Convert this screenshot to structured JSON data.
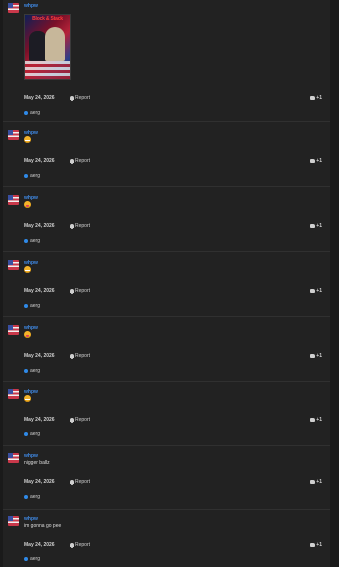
{
  "attachment": {
    "title_text": "Block & Stack"
  },
  "posts": [
    {
      "username": "whpw",
      "date": "May 24, 2026",
      "report_label": "Report",
      "like_label": "+1",
      "reactor": "aerg"
    },
    {
      "username": "whpw",
      "emoji": "grinning-emoji",
      "date": "May 24, 2026",
      "report_label": "Report",
      "like_label": "+1",
      "reactor": "aerg"
    },
    {
      "username": "whpw",
      "emoji": "tongue-emoji",
      "date": "May 24, 2026",
      "report_label": "Report",
      "like_label": "+1",
      "reactor": "aerg"
    },
    {
      "username": "whpw",
      "emoji": "grinning-emoji",
      "date": "May 24, 2026",
      "report_label": "Report",
      "like_label": "+1",
      "reactor": "aerg"
    },
    {
      "username": "whpw",
      "emoji": "tongue-emoji",
      "date": "May 24, 2026",
      "report_label": "Report",
      "like_label": "+1",
      "reactor": "aerg"
    },
    {
      "username": "whpw",
      "emoji": "grinning-emoji",
      "date": "May 24, 2026",
      "report_label": "Report",
      "like_label": "+1",
      "reactor": "aerg"
    },
    {
      "username": "whpw",
      "text": "nigger ballz",
      "date": "May 24, 2026",
      "report_label": "Report",
      "like_label": "+1",
      "reactor": "aerg"
    },
    {
      "username": "whpw",
      "text": "im gonna go pee",
      "date": "May 24, 2026",
      "report_label": "Report",
      "like_label": "+1",
      "reactor": "aerg"
    }
  ],
  "colors": {
    "username": "#3f8ae6",
    "background": "#222222",
    "reaction": "#2f8ae8"
  }
}
